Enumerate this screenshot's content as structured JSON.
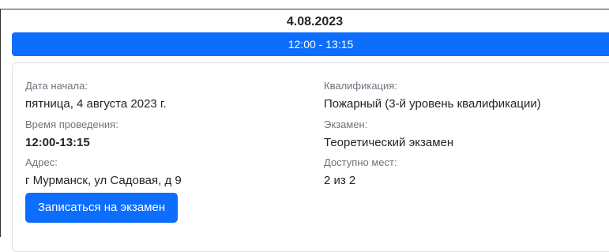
{
  "date": "4.08.2023",
  "time_slot": "12:00 - 13:15",
  "details": {
    "start_date_label": "Дата начала:",
    "start_date_value": "пятница, 4 августа 2023 г.",
    "duration_label": "Время проведения:",
    "duration_value": "12:00-13:15",
    "address_label": "Адрес:",
    "address_value": "г Мурманск, ул Садовая, д 9",
    "qualification_label": "Квалификация:",
    "qualification_value": "Пожарный (3-й уровень квалификации)",
    "exam_label": "Экзамен:",
    "exam_value": "Теоретический экзамен",
    "seats_label": "Доступно мест:",
    "seats_value": "2 из 2"
  },
  "enroll_button_label": "Записаться на экзамен",
  "colors": {
    "accent": "#0d6efd",
    "label_text": "#6c757d",
    "body_text": "#212529"
  }
}
